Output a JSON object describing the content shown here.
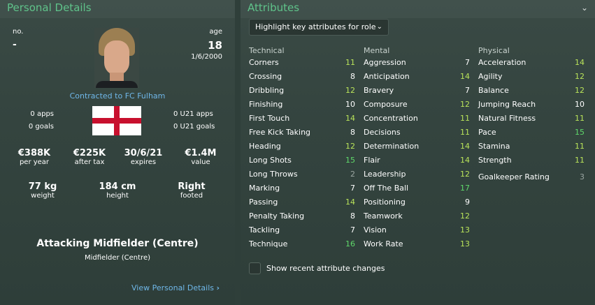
{
  "left": {
    "title": "Personal Details",
    "no_label": "no.",
    "no_value": "-",
    "age_label": "age",
    "age_value": "18",
    "dob": "1/6/2000",
    "contract": "Contracted to FC Fulham",
    "apps": "0 apps",
    "goals": "0 goals",
    "u21_apps": "0 U21 apps",
    "u21_goals": "0 U21 goals",
    "finance": [
      {
        "value": "€388K",
        "label": "per year"
      },
      {
        "value": "€225K",
        "label": "after tax"
      },
      {
        "value": "30/6/21",
        "label": "expires"
      },
      {
        "value": "€1.4M",
        "label": "value"
      }
    ],
    "physical": [
      {
        "value": "77 kg",
        "label": "weight"
      },
      {
        "value": "184 cm",
        "label": "height"
      },
      {
        "value": "Right",
        "label": "footed"
      }
    ],
    "position": "Attacking Midfielder (Centre)",
    "position_sub": "Midfielder (Centre)",
    "view_link": "View Personal Details",
    "link_chevron": "›"
  },
  "right": {
    "title": "Attributes",
    "collapse_icon": "⌄",
    "dropdown_label": "Highlight key attributes for role",
    "dropdown_chevron": "⌄",
    "checkbox_label": "Show recent attribute changes",
    "columns": [
      {
        "heading": "Technical",
        "items": [
          {
            "name": "Corners",
            "value": "11"
          },
          {
            "name": "Crossing",
            "value": "8"
          },
          {
            "name": "Dribbling",
            "value": "12"
          },
          {
            "name": "Finishing",
            "value": "10"
          },
          {
            "name": "First Touch",
            "value": "14"
          },
          {
            "name": "Free Kick Taking",
            "value": "8"
          },
          {
            "name": "Heading",
            "value": "12"
          },
          {
            "name": "Long Shots",
            "value": "15"
          },
          {
            "name": "Long Throws",
            "value": "2"
          },
          {
            "name": "Marking",
            "value": "7"
          },
          {
            "name": "Passing",
            "value": "14"
          },
          {
            "name": "Penalty Taking",
            "value": "8"
          },
          {
            "name": "Tackling",
            "value": "7"
          },
          {
            "name": "Technique",
            "value": "16"
          }
        ]
      },
      {
        "heading": "Mental",
        "items": [
          {
            "name": "Aggression",
            "value": "7"
          },
          {
            "name": "Anticipation",
            "value": "14"
          },
          {
            "name": "Bravery",
            "value": "7"
          },
          {
            "name": "Composure",
            "value": "12"
          },
          {
            "name": "Concentration",
            "value": "11"
          },
          {
            "name": "Decisions",
            "value": "11"
          },
          {
            "name": "Determination",
            "value": "14"
          },
          {
            "name": "Flair",
            "value": "14"
          },
          {
            "name": "Leadership",
            "value": "12"
          },
          {
            "name": "Off The Ball",
            "value": "17"
          },
          {
            "name": "Positioning",
            "value": "9"
          },
          {
            "name": "Teamwork",
            "value": "12"
          },
          {
            "name": "Vision",
            "value": "13"
          },
          {
            "name": "Work Rate",
            "value": "13"
          }
        ]
      },
      {
        "heading": "Physical",
        "items": [
          {
            "name": "Acceleration",
            "value": "14"
          },
          {
            "name": "Agility",
            "value": "12"
          },
          {
            "name": "Balance",
            "value": "12"
          },
          {
            "name": "Jumping Reach",
            "value": "10"
          },
          {
            "name": "Natural Fitness",
            "value": "11"
          },
          {
            "name": "Pace",
            "value": "15"
          },
          {
            "name": "Stamina",
            "value": "11"
          },
          {
            "name": "Strength",
            "value": "11"
          }
        ],
        "extra": {
          "name": "Goalkeeper Rating",
          "value": "3"
        }
      }
    ]
  },
  "colors": {
    "accent": "#5fc38a",
    "link": "#6fb7e8",
    "value_low": "#9aa5a1",
    "value_mid": "#ffffff",
    "value_good": "#b9e35a",
    "value_high": "#5fd86a"
  }
}
